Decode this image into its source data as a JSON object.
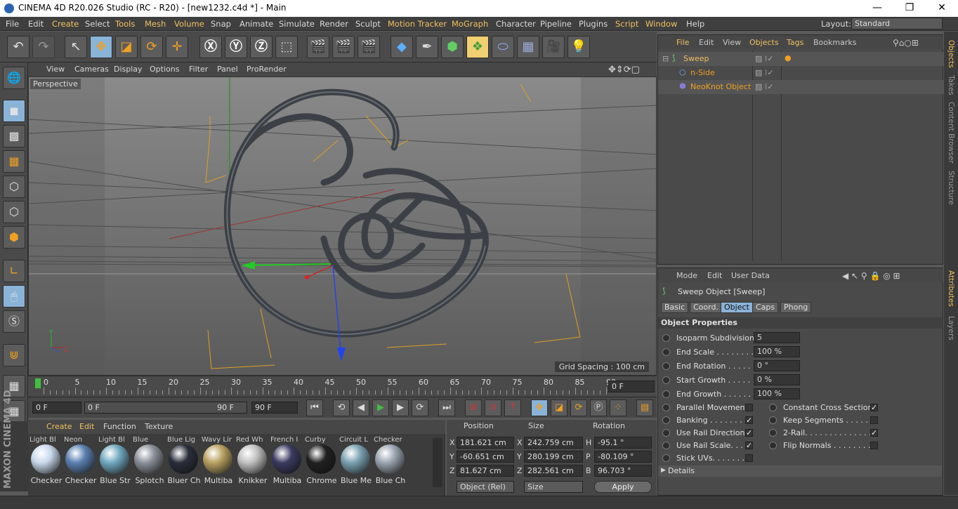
{
  "window": {
    "title": "CINEMA 4D R20.026 Studio (RC - R20) - [new1232.c4d *] - Main"
  },
  "menubar": {
    "items": [
      "File",
      "Edit",
      "Create",
      "Select",
      "Tools",
      "Mesh",
      "Volume",
      "Snap",
      "Animate",
      "Simulate",
      "Render",
      "Sculpt",
      "Motion Tracker",
      "MoGraph",
      "Character",
      "Pipeline",
      "Plugins",
      "Script",
      "Window",
      "Help"
    ],
    "layout_label": "Layout:",
    "layout_value": "Standard"
  },
  "viewport": {
    "menu": [
      "View",
      "Cameras",
      "Display",
      "Options",
      "Filter",
      "Panel",
      "ProRender"
    ],
    "label": "Perspective",
    "grid_spacing": "Grid Spacing : 100 cm",
    "axis": {
      "y": "Y",
      "z": "Z",
      "x": "X"
    }
  },
  "timeline": {
    "ticks": [
      "0",
      "5",
      "10",
      "15",
      "20",
      "25",
      "30",
      "35",
      "40",
      "45",
      "50",
      "55",
      "60",
      "65",
      "70",
      "75",
      "80",
      "85",
      "90"
    ],
    "current_frame": "0 F"
  },
  "transport": {
    "start": "0 F",
    "slider_start": "0 F",
    "slider_end": "90 F",
    "end": "90 F"
  },
  "materials": {
    "menu": [
      "Create",
      "Edit",
      "Function",
      "Texture"
    ],
    "top_names": [
      "Light Bl",
      "Neon",
      "Light Bl",
      "Blue",
      "Blue Lig",
      "Wavy Lir",
      "Red Wh",
      "French I",
      "Curby",
      "Circuit L",
      "Checker"
    ],
    "names": [
      "Checker",
      "Checker",
      "Blue Str",
      "Splotch",
      "Bluer Ch",
      "Multiba",
      "Knikker",
      "Multiba",
      "Chrome",
      "Blue Me",
      "Blue Ch"
    ]
  },
  "coord": {
    "headers": [
      "Position",
      "Size",
      "Rotation"
    ],
    "rows": [
      {
        "axis": "X",
        "pos": "181.621 cm",
        "saxis": "X",
        "size": "242.759 cm",
        "raxis": "H",
        "rot": "-95.1 °"
      },
      {
        "axis": "Y",
        "pos": "-60.651 cm",
        "saxis": "Y",
        "size": "280.199 cm",
        "raxis": "P",
        "rot": "-80.109 °"
      },
      {
        "axis": "Z",
        "pos": "81.627 cm",
        "saxis": "Z",
        "size": "282.561 cm",
        "raxis": "B",
        "rot": "96.703 °"
      }
    ],
    "mode": "Object (Rel)",
    "size_mode": "Size",
    "apply": "Apply"
  },
  "objects": {
    "menu": [
      "File",
      "Edit",
      "View",
      "Objects",
      "Tags",
      "Bookmarks"
    ],
    "items": [
      "Sweep",
      "n-Side",
      "NeoKnot Object"
    ]
  },
  "attributes": {
    "menu": [
      "Mode",
      "Edit",
      "User Data"
    ],
    "object_title": "Sweep Object [Sweep]",
    "tabs": [
      "Basic",
      "Coord.",
      "Object",
      "Caps",
      "Phong"
    ],
    "section": "Object Properties",
    "props": [
      {
        "label": "Isoparm Subdivision",
        "value": "5"
      },
      {
        "label": "End Scale . . . . . . . . .",
        "value": "100 %"
      },
      {
        "label": "End Rotation . . . . . .",
        "value": "0 °"
      },
      {
        "label": "Start Growth . . . . . .",
        "value": "0 %"
      },
      {
        "label": "End Growth . . . . . . .",
        "value": "100 %"
      }
    ],
    "checks_left": [
      "Parallel Movement",
      "Banking . . . . . . . .",
      "Use Rail Direction",
      "Use Rail Scale. . . .",
      "Stick UVs. . . . . . . ."
    ],
    "checks_right": [
      "Constant Cross Section",
      "Keep Segments . . . . . . .",
      "2-Rail. . . . . . . . . . . . . .",
      "Flip Normals . . . . . . . . ."
    ],
    "details": "Details"
  },
  "side_tabs_top": [
    "Objects",
    "Takes",
    "Content Browser",
    "Structure"
  ],
  "side_tabs_bottom": [
    "Attributes",
    "Layers"
  ],
  "brand": "MAXON CINEMA 4D"
}
